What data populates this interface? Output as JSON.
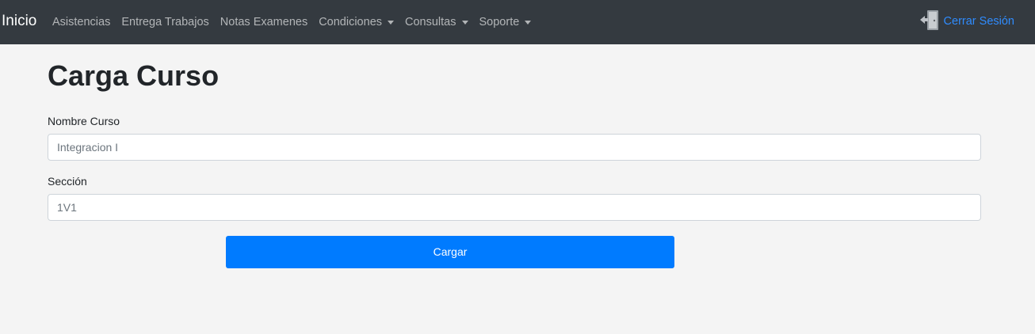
{
  "navbar": {
    "brand": "Inicio",
    "links": [
      {
        "label": "Asistencias"
      },
      {
        "label": "Entrega Trabajos"
      },
      {
        "label": "Notas Examenes"
      },
      {
        "label": "Condiciones"
      },
      {
        "label": "Consultas"
      },
      {
        "label": "Soporte"
      }
    ],
    "logout": {
      "label": "Cerrar Sesión",
      "icon": "door-exit-icon"
    },
    "background_color": "#343a40",
    "accent_color": "#2f8cff"
  },
  "page": {
    "title": "Carga Curso",
    "form": {
      "nombre_label": "Nombre Curso",
      "nombre_value": "Integracion I",
      "seccion_label": "Sección",
      "seccion_value": "1V1",
      "submit_label": "Cargar",
      "submit_color": "#007bff"
    }
  }
}
